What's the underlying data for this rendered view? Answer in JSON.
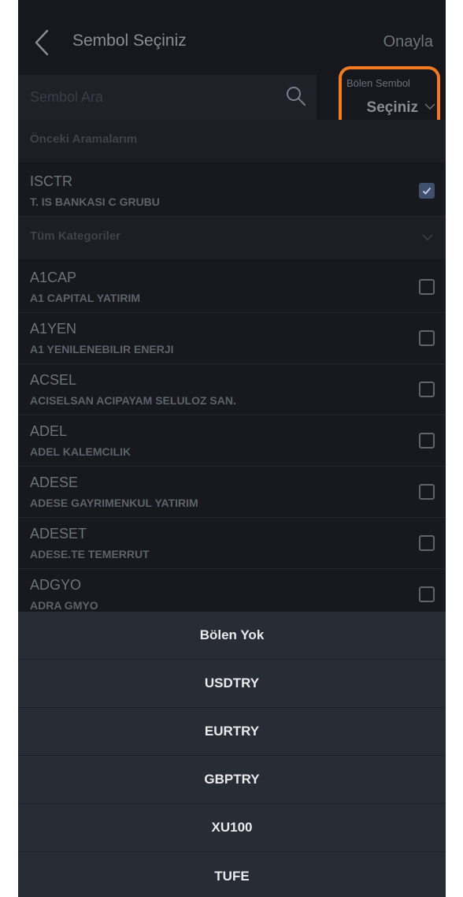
{
  "header": {
    "title": "Sembol Seçiniz",
    "confirm_label": "Onayla"
  },
  "search": {
    "placeholder": "Sembol Ara"
  },
  "divisor": {
    "label": "Bölen Sembol",
    "value": "Seçiniz"
  },
  "recent": {
    "label": "Önceki Aramalarım",
    "items": [
      {
        "code": "ISCTR",
        "name": "T. IS BANKASI C GRUBU",
        "checked": true
      }
    ]
  },
  "categories": {
    "label": "Tüm Kategoriler"
  },
  "symbols": [
    {
      "code": "A1CAP",
      "name": "A1 CAPITAL YATIRIM",
      "checked": false
    },
    {
      "code": "A1YEN",
      "name": "A1 YENILENEBILIR ENERJI",
      "checked": false
    },
    {
      "code": "ACSEL",
      "name": "ACISELSAN ACIPAYAM SELULOZ SAN.",
      "checked": false
    },
    {
      "code": "ADEL",
      "name": "ADEL KALEMCILIK",
      "checked": false
    },
    {
      "code": "ADESE",
      "name": "ADESE GAYRIMENKUL YATIRIM",
      "checked": false
    },
    {
      "code": "ADESET",
      "name": "ADESE.TE TEMERRUT",
      "checked": false
    },
    {
      "code": "ADGYO",
      "name": "ADRA GMYO",
      "checked": false
    }
  ],
  "divisor_options": [
    "Bölen Yok",
    "USDTRY",
    "EURTRY",
    "GBPTRY",
    "XU100",
    "TUFE"
  ],
  "colors": {
    "background": "#16181d",
    "highlight": "#f47a1f",
    "sheet": "#272c35",
    "checked": "#3f4f6e"
  }
}
